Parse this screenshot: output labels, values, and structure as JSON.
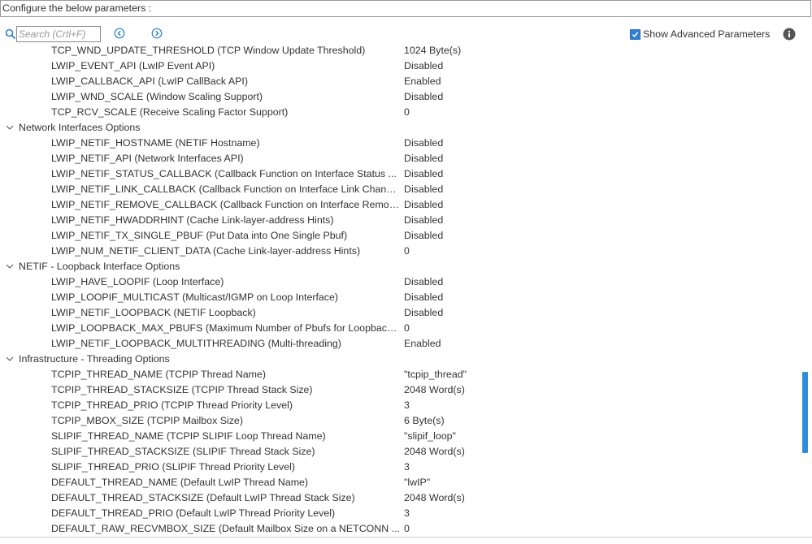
{
  "header": {
    "title": "Configure the below parameters :"
  },
  "toolbar": {
    "search_placeholder": "Search (Crtl+F)",
    "show_advanced_label": "Show Advanced Parameters",
    "show_advanced_checked": true,
    "search_icon": "search-icon",
    "prev_icon": "arrow-left-circle-icon",
    "next_icon": "arrow-right-circle-icon",
    "info_icon": "info-icon"
  },
  "colors": {
    "accent": "#2c8fde",
    "checkbox": "#2f7fd6",
    "icon": "#2a7fc9"
  },
  "rows": [
    {
      "type": "param",
      "name": "TCP_WND_UPDATE_THRESHOLD (TCP Window Update Threshold)",
      "value": "1024 Byte(s)"
    },
    {
      "type": "param",
      "name": "LWIP_EVENT_API (LwIP Event API)",
      "value": "Disabled"
    },
    {
      "type": "param",
      "name": "LWIP_CALLBACK_API (LwIP CallBack API)",
      "value": "Enabled"
    },
    {
      "type": "param",
      "name": "LWIP_WND_SCALE (Window Scaling Support)",
      "value": "Disabled"
    },
    {
      "type": "param",
      "name": "TCP_RCV_SCALE (Receive Scaling Factor Support)",
      "value": "0"
    },
    {
      "type": "group",
      "name": "Network Interfaces Options"
    },
    {
      "type": "param",
      "name": "LWIP_NETIF_HOSTNAME (NETIF Hostname)",
      "value": "Disabled"
    },
    {
      "type": "param",
      "name": "LWIP_NETIF_API (Network Interfaces API)",
      "value": "Disabled"
    },
    {
      "type": "param",
      "name": "LWIP_NETIF_STATUS_CALLBACK (Callback Function on Interface Status ...",
      "value": "Disabled"
    },
    {
      "type": "param",
      "name": "LWIP_NETIF_LINK_CALLBACK (Callback Function on Interface Link Changes)",
      "value": "Disabled"
    },
    {
      "type": "param",
      "name": "LWIP_NETIF_REMOVE_CALLBACK (Callback Function on Interface Removal)",
      "value": "Disabled"
    },
    {
      "type": "param",
      "name": "LWIP_NETIF_HWADDRHINT (Cache Link-layer-address Hints)",
      "value": "Disabled"
    },
    {
      "type": "param",
      "name": "LWIP_NETIF_TX_SINGLE_PBUF (Put Data into One Single Pbuf)",
      "value": "Disabled"
    },
    {
      "type": "param",
      "name": "LWIP_NUM_NETIF_CLIENT_DATA (Cache Link-layer-address Hints)",
      "value": "0"
    },
    {
      "type": "group",
      "name": "NETIF - Loopback Interface Options"
    },
    {
      "type": "param",
      "name": "LWIP_HAVE_LOOPIF (Loop Interface)",
      "value": "Disabled"
    },
    {
      "type": "param",
      "name": "LWIP_LOOPIF_MULTICAST (Multicast/IGMP on Loop Interface)",
      "value": "Disabled"
    },
    {
      "type": "param",
      "name": "LWIP_NETIF_LOOPBACK (NETIF Loopback)",
      "value": "Disabled"
    },
    {
      "type": "param",
      "name": "LWIP_LOOPBACK_MAX_PBUFS (Maximum Number of Pbufs for Loopback ...",
      "value": "0"
    },
    {
      "type": "param",
      "name": "LWIP_NETIF_LOOPBACK_MULTITHREADING (Multi-threading)",
      "value": "Enabled"
    },
    {
      "type": "group",
      "name": "Infrastructure - Threading Options"
    },
    {
      "type": "param",
      "name": "TCPIP_THREAD_NAME (TCPIP Thread Name)",
      "value": "\"tcpip_thread\""
    },
    {
      "type": "param",
      "name": "TCPIP_THREAD_STACKSIZE (TCPIP Thread Stack Size)",
      "value": "2048 Word(s)"
    },
    {
      "type": "param",
      "name": "TCPIP_THREAD_PRIO (TCPIP Thread Priority Level)",
      "value": "3"
    },
    {
      "type": "param",
      "name": "TCPIP_MBOX_SIZE (TCPIP Mailbox Size)",
      "value": "6 Byte(s)"
    },
    {
      "type": "param",
      "name": "SLIPIF_THREAD_NAME (TCPIP SLIPIF Loop Thread Name)",
      "value": "\"slipif_loop\""
    },
    {
      "type": "param",
      "name": "SLIPIF_THREAD_STACKSIZE (SLIPIF Thread Stack Size)",
      "value": "2048 Word(s)"
    },
    {
      "type": "param",
      "name": "SLIPIF_THREAD_PRIO (SLIPIF Thread Priority Level)",
      "value": "3"
    },
    {
      "type": "param",
      "name": "DEFAULT_THREAD_NAME (Default LwIP Thread Name)",
      "value": "\"lwIP\""
    },
    {
      "type": "param",
      "name": "DEFAULT_THREAD_STACKSIZE (Default LwIP Thread Stack Size)",
      "value": "2048 Word(s)"
    },
    {
      "type": "param",
      "name": "DEFAULT_THREAD_PRIO (Default LwIP Thread Priority Level)",
      "value": "3"
    },
    {
      "type": "param",
      "name": "DEFAULT_RAW_RECVMBOX_SIZE (Default Mailbox Size on a NETCONN ...",
      "value": "0"
    }
  ]
}
